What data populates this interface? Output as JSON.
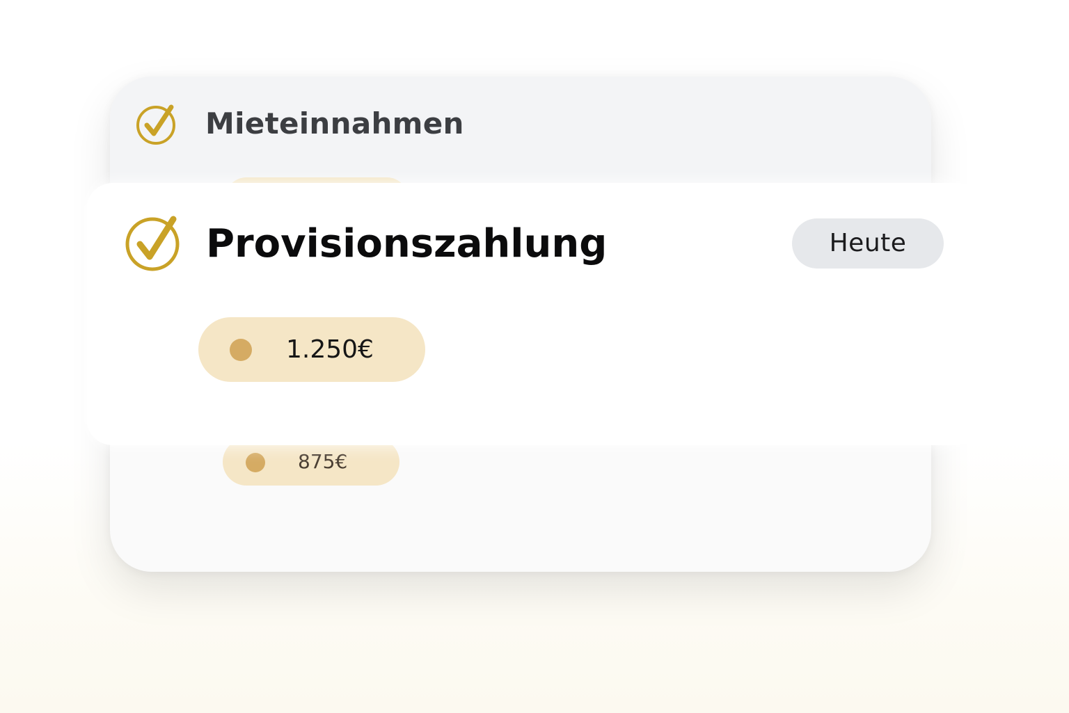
{
  "colors": {
    "accent_gold": "#c9a227",
    "pill_background": "#f5e6c6",
    "pill_dot": "#d5ab63",
    "badge_background": "#e6e8eb"
  },
  "back_card": {
    "icon": "check-circle-icon",
    "title": "Mieteinnahmen",
    "amount": "875€"
  },
  "front_card": {
    "icon": "check-circle-icon",
    "title": "Provisionszahlung",
    "date_badge": "Heute",
    "amount": "1.250€"
  }
}
